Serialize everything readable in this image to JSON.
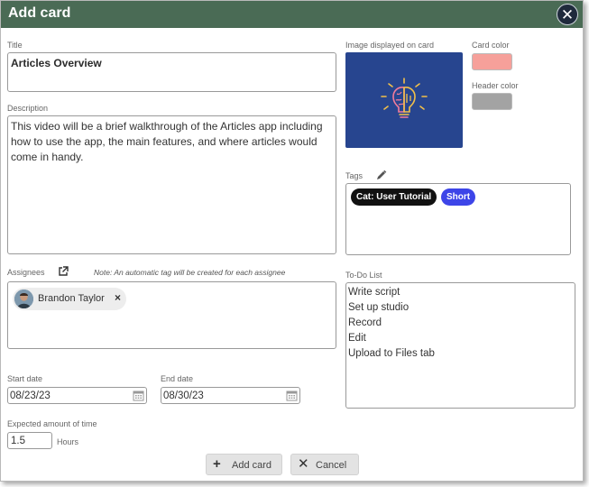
{
  "dialog": {
    "title": "Add card",
    "close_icon": "close-icon"
  },
  "title_field": {
    "label": "Title",
    "value": "Articles Overview"
  },
  "description_field": {
    "label": "Description",
    "value": "This video will be a brief walkthrough of the Articles app including how to use the app, the main features, and where articles would come in handy."
  },
  "image": {
    "label": "Image displayed on card",
    "icon": "lightbulb-brain-icon",
    "background_color": "#27458f"
  },
  "card_color": {
    "label": "Card color",
    "value": "#f6a09a"
  },
  "header_color": {
    "label": "Header color",
    "value": "#a3a3a3"
  },
  "tags": {
    "label": "Tags",
    "edit_icon": "pencil-icon",
    "items": [
      {
        "label": "Cat: User Tutorial",
        "color": "#111111"
      },
      {
        "label": "Short",
        "color": "#3d45e8"
      }
    ]
  },
  "assignees": {
    "label": "Assignees",
    "link_icon": "external-link-icon",
    "note": "Note: An automatic tag will be created for each assignee",
    "items": [
      {
        "name": "Brandon Taylor",
        "remove": "×"
      }
    ]
  },
  "todo": {
    "label": "To-Do List",
    "items": [
      "Write script",
      "Set up studio",
      "Record",
      "Edit",
      "Upload to Files tab"
    ]
  },
  "start_date": {
    "label": "Start date",
    "value": "08/23/23",
    "icon": "calendar-icon"
  },
  "end_date": {
    "label": "End date",
    "value": "08/30/23",
    "icon": "calendar-icon"
  },
  "expected_time": {
    "label": "Expected amount of time",
    "value": "1.5",
    "unit": "Hours"
  },
  "buttons": {
    "add_label": "Add card",
    "cancel_label": "Cancel"
  },
  "colors": {
    "titlebar": "#4a6b55",
    "close_button": "#1f2a3c"
  }
}
